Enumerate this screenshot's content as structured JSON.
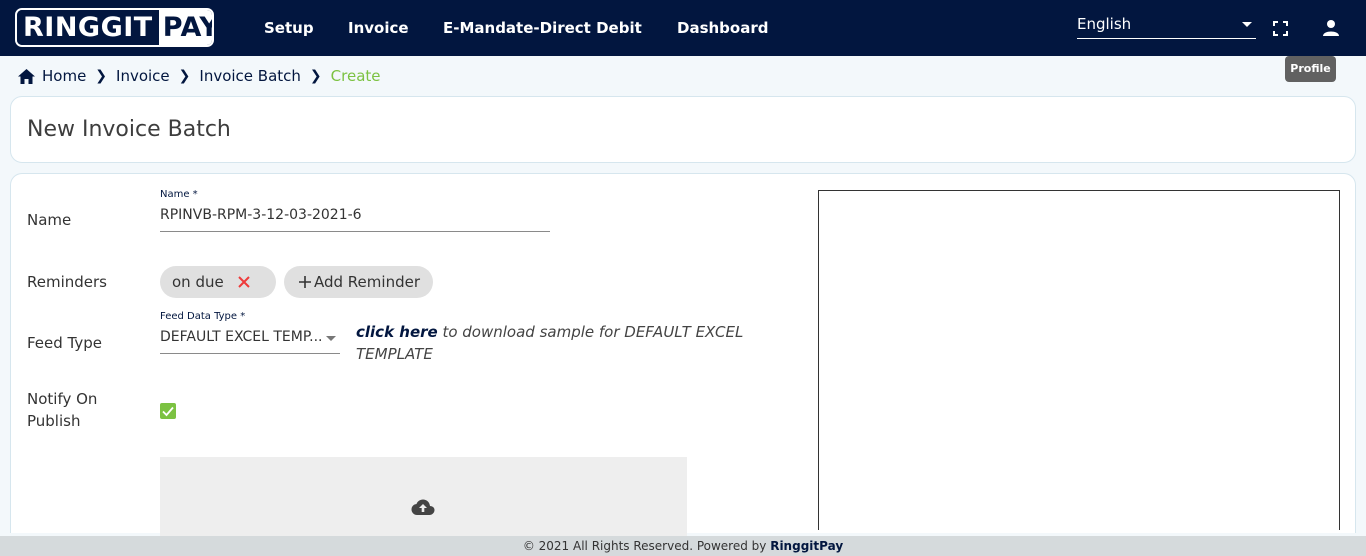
{
  "logo": {
    "part1": "RINGGIT",
    "part2": "PAY"
  },
  "nav": {
    "items": [
      "Setup",
      "Invoice",
      "E-Mandate-Direct Debit",
      "Dashboard"
    ]
  },
  "language": {
    "selected": "English"
  },
  "tooltip": {
    "text": "Profile"
  },
  "breadcrumb": {
    "items": [
      "Home",
      "Invoice",
      "Invoice Batch",
      "Create"
    ]
  },
  "page": {
    "title": "New Invoice Batch"
  },
  "form": {
    "name": {
      "label": "Name",
      "field_label": "Name *",
      "value": "RPINVB-RPM-3-12-03-2021-6"
    },
    "reminders": {
      "label": "Reminders",
      "chip": "on due",
      "add_label": "Add Reminder"
    },
    "feed_type": {
      "label": "Feed Type",
      "field_label": "Feed Data Type *",
      "value": "DEFAULT EXCEL TEMP...",
      "link_text": "click here",
      "desc_text": " to download sample for DEFAULT EXCEL TEMPLATE"
    },
    "notify": {
      "label": "Notify On Publish",
      "checked": true
    }
  },
  "footer": {
    "text": "© 2021 All Rights Reserved. Powered by ",
    "brand": "RinggitPay"
  },
  "colors": {
    "navy": "#02163f",
    "accent": "#7cc242",
    "chip": "#e0e0e0"
  },
  "icons": [
    "home-icon",
    "chevron-right-icon",
    "fullscreen-icon",
    "person-icon",
    "close-icon",
    "plus-icon",
    "check-icon",
    "cloud-upload-icon",
    "caret-down-icon"
  ]
}
